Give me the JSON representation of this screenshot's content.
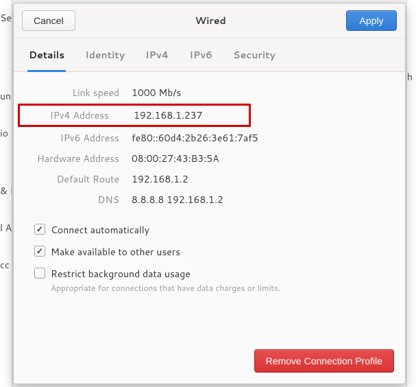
{
  "bg": {
    "left": [
      "Se",
      "",
      "",
      "un",
      "",
      "io",
      "",
      "& L",
      "",
      "l A",
      "",
      "cc"
    ],
    "right": [
      "h",
      "",
      "",
      "",
      "",
      ""
    ]
  },
  "header": {
    "cancel": "Cancel",
    "title": "Wired",
    "apply": "Apply"
  },
  "tabs": [
    {
      "id": "details",
      "label": "Details",
      "active": true
    },
    {
      "id": "identity",
      "label": "Identity",
      "active": false
    },
    {
      "id": "ipv4",
      "label": "IPv4",
      "active": false
    },
    {
      "id": "ipv6",
      "label": "IPv6",
      "active": false
    },
    {
      "id": "security",
      "label": "Security",
      "active": false
    }
  ],
  "details": {
    "link_speed": {
      "label": "Link speed",
      "value": "1000 Mb/s"
    },
    "ipv4": {
      "label": "IPv4 Address",
      "value": "192.168.1.237",
      "highlighted": true
    },
    "ipv6": {
      "label": "IPv6 Address",
      "value": "fe80::60d4:2b26:3e61:7af5"
    },
    "hw": {
      "label": "Hardware Address",
      "value": "08:00:27:43:B3:5A"
    },
    "route": {
      "label": "Default Route",
      "value": "192.168.1.2"
    },
    "dns": {
      "label": "DNS",
      "value": "8.8.8.8 192.168.1.2"
    }
  },
  "checks": {
    "auto": {
      "label": "Connect automatically",
      "checked": true
    },
    "share": {
      "label": "Make available to other users",
      "checked": true
    },
    "restrict": {
      "label": "Restrict background data usage",
      "sub": "Appropriate for connections that have data charges or limits.",
      "checked": false
    }
  },
  "footer": {
    "remove": "Remove Connection Profile"
  }
}
